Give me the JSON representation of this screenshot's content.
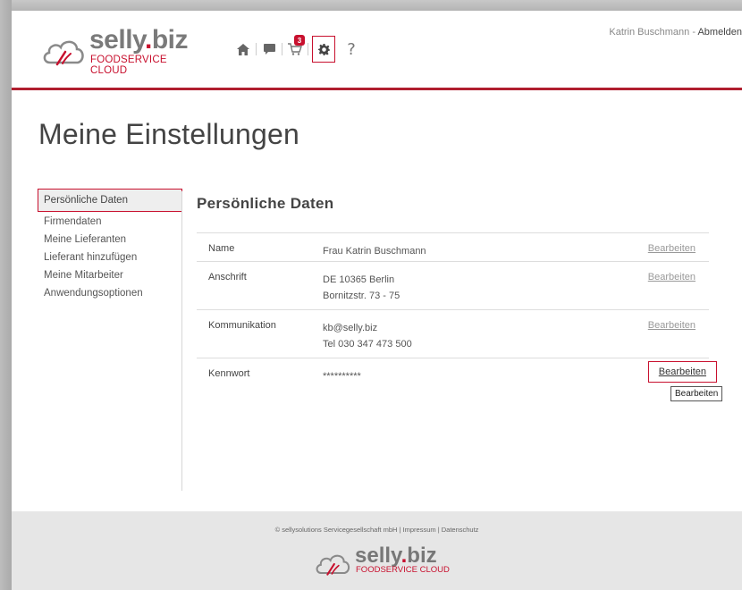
{
  "header": {
    "logo_word_main": "selly",
    "logo_word_dot": ".",
    "logo_word_biz": "biz",
    "logo_tagline": "FOODSERVICE CLOUD",
    "cart_count": "3",
    "help_symbol": "?",
    "user_name": "Katrin Buschmann",
    "separator": "-",
    "logout_label": "Abmelden",
    "icons": [
      "home-icon",
      "chat-icon",
      "cart-icon",
      "gear-icon",
      "help-icon"
    ]
  },
  "page": {
    "title": "Meine Einstellungen"
  },
  "sidebar": {
    "items": [
      {
        "label": "Persönliche Daten"
      },
      {
        "label": "Firmendaten"
      },
      {
        "label": "Meine Lieferanten"
      },
      {
        "label": "Lieferant hinzufügen"
      },
      {
        "label": "Meine Mitarbeiter"
      },
      {
        "label": "Anwendungsoptionen"
      }
    ]
  },
  "content": {
    "section_title": "Persönliche Daten",
    "rows": [
      {
        "label": "Name",
        "value_lines": [
          "Frau Katrin Buschmann"
        ],
        "edit": "Bearbeiten"
      },
      {
        "label": "Anschrift",
        "value_lines": [
          "DE 10365 Berlin",
          "Bornitzstr. 73 - 75"
        ],
        "edit": "Bearbeiten"
      },
      {
        "label": "Kommunikation",
        "value_lines": [
          "kb@selly.biz",
          "Tel 030 347 473 500"
        ],
        "edit": "Bearbeiten"
      },
      {
        "label": "Kennwort",
        "value_lines": [
          "**********"
        ],
        "edit": "Bearbeiten"
      }
    ],
    "tooltip": "Bearbeiten"
  },
  "footer": {
    "text": "© sellysolutions Servicegesellschaft mbH | Impressum | Datenschutz",
    "logo_word_main": "selly",
    "logo_word_dot": ".",
    "logo_word_biz": "biz",
    "logo_tagline": "FOODSERVICE CLOUD"
  },
  "colors": {
    "brand_red": "#c8102e",
    "header_line": "#b01e2e",
    "logo_gray": "#7a7a7a"
  }
}
